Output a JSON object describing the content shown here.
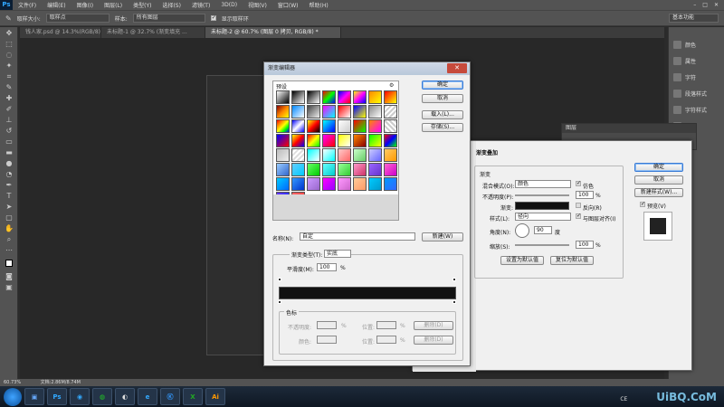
{
  "app": {
    "logo": "Ps",
    "menu": [
      "文件(F)",
      "编辑(E)",
      "图像(I)",
      "图层(L)",
      "类型(Y)",
      "选择(S)",
      "滤镜(T)",
      "3D(D)",
      "视图(V)",
      "窗口(W)",
      "帮助(H)"
    ]
  },
  "options": {
    "sample_size_label": "取样大小:",
    "sample_size": "取样点",
    "sample_label": "样本:",
    "sample": "所有图层",
    "show_ring": "显示取样环",
    "workspace": "基本功能"
  },
  "tabs": [
    "钱人家.psd @ 14.3%(RGB/8)",
    "未标题-1 @ 32.7% (渐变填充 ...",
    "未标题-2 @ 60.7% (图层 0 拷贝, RGB/8) *"
  ],
  "right_panel": [
    "颜色",
    "属性",
    "字符",
    "段落样式",
    "字符样式",
    "3D"
  ],
  "layers_title": "图层",
  "status": {
    "zoom": "60.73%",
    "doc": "文档:2.86M/8.74M"
  },
  "gradient_editor": {
    "title": "渐变编辑器",
    "presets_label": "预设",
    "buttons": {
      "ok": "确定",
      "cancel": "取消",
      "load": "载入(L)...",
      "save": "存储(S)...",
      "new": "新建(W)"
    },
    "name_label": "名称(N):",
    "name_value": "自定",
    "type_label": "渐变类型(T):",
    "type_value": "实底",
    "smooth_label": "平滑度(M):",
    "smooth_value": "100",
    "pct": "%",
    "stops_label": "色标",
    "opacity_label": "不透明度:",
    "location_label": "位置:",
    "color_label": "颜色:",
    "delete_label": "删除(D)"
  },
  "layer_style": {
    "title": "渐变叠加",
    "section": "渐变",
    "blend_label": "混合模式(O):",
    "blend_value": "颜色",
    "dither_label": "仿色",
    "opacity_label": "不透明度(P):",
    "opacity_value": "100",
    "pct": "%",
    "gradient_label": "渐变:",
    "reverse_label": "反向(R)",
    "style_label": "样式(L):",
    "style_value": "径向",
    "align_label": "与图层对齐(I)",
    "angle_label": "角度(N):",
    "angle_value": "90",
    "degree": "度",
    "scale_label": "缩放(S):",
    "scale_value": "100",
    "set_default": "设置为默认值",
    "reset_default": "复位为默认值",
    "ok": "确定",
    "cancel": "取消",
    "new_style": "新建样式(W)...",
    "preview": "预览(V)"
  },
  "taskbar": {
    "tray_text": "CE",
    "watermark": "UiBQ.CoM"
  },
  "colors": {
    "ps_bg": "#535353",
    "accent": "#3a7bd5"
  }
}
